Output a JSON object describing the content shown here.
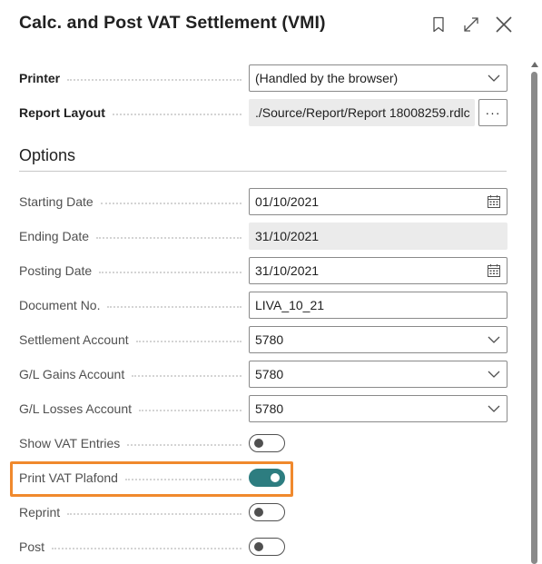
{
  "header": {
    "title": "Calc. and Post VAT Settlement (VMI)",
    "icons": [
      "bookmark-icon",
      "expand-icon",
      "close-icon"
    ]
  },
  "general": {
    "printer": {
      "label": "Printer",
      "value": "(Handled by the browser)"
    },
    "report_layout": {
      "label": "Report Layout",
      "value": "./Source/Report/Report 18008259.rdlc",
      "more_label": "···"
    }
  },
  "options": {
    "title": "Options",
    "starting_date": {
      "label": "Starting Date",
      "value": "01/10/2021"
    },
    "ending_date": {
      "label": "Ending Date",
      "value": "31/10/2021"
    },
    "posting_date": {
      "label": "Posting Date",
      "value": "31/10/2021"
    },
    "document_no": {
      "label": "Document No.",
      "value": "LIVA_10_21"
    },
    "settlement_account": {
      "label": "Settlement Account",
      "value": "5780"
    },
    "gl_gains_account": {
      "label": "G/L Gains Account",
      "value": "5780"
    },
    "gl_losses_account": {
      "label": "G/L Losses Account",
      "value": "5780"
    },
    "show_vat_entries": {
      "label": "Show VAT Entries",
      "checked": false
    },
    "print_vat_plafond": {
      "label": "Print VAT Plafond",
      "checked": true
    },
    "reprint": {
      "label": "Reprint",
      "checked": false
    },
    "post": {
      "label": "Post",
      "checked": false
    }
  },
  "colors": {
    "accent": "#2d7d80",
    "highlight": "#f0892d"
  }
}
